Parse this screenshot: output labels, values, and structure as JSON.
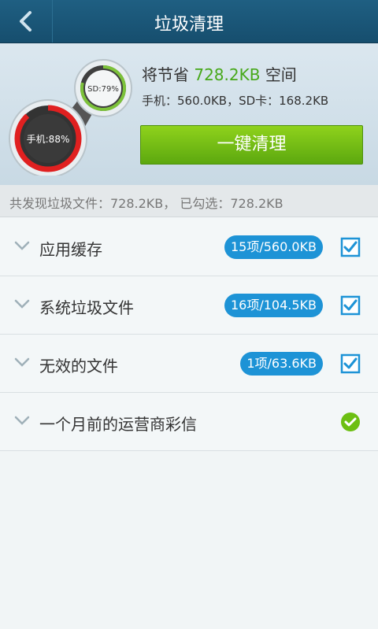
{
  "header": {
    "title": "垃圾清理",
    "back_icon": "chevron-left-icon"
  },
  "summary": {
    "save_prefix": "将节省",
    "save_value": "728.2KB",
    "save_suffix": "空间",
    "storage_line": "手机：560.0KB，SD卡：168.2KB",
    "phone_gauge": {
      "label": "手机:88%",
      "percent": 88
    },
    "sd_gauge": {
      "label": "SD:79%",
      "percent": 79
    },
    "clean_button": "一键清理"
  },
  "found": "共发现垃圾文件：728.2KB， 已勾选：728.2KB",
  "categories": [
    {
      "label": "应用缓存",
      "badge": "15项/560.0KB",
      "check": "checkbox-checked"
    },
    {
      "label": "系统垃圾文件",
      "badge": "16项/104.5KB",
      "check": "checkbox-checked"
    },
    {
      "label": "无效的文件",
      "badge": "1项/63.6KB",
      "check": "checkbox-checked"
    },
    {
      "label": "一个月前的运营商彩信",
      "badge": "",
      "check": "green-check-circle"
    }
  ],
  "colors": {
    "header": "#1a5677",
    "accent_green": "#6cbf12",
    "badge_blue": "#1d93d6",
    "gauge_red": "#e02020"
  }
}
